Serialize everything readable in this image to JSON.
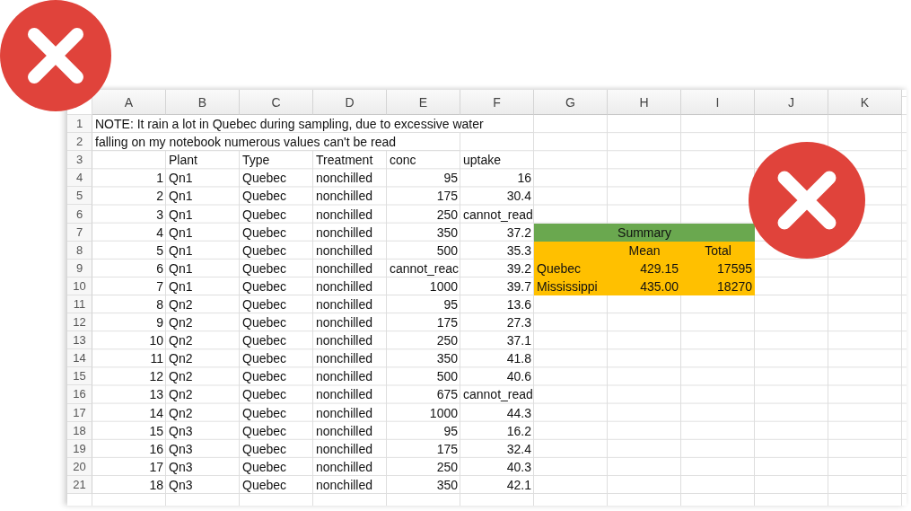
{
  "columns": [
    "A",
    "B",
    "C",
    "D",
    "E",
    "F",
    "G",
    "H",
    "I",
    "J",
    "K"
  ],
  "note_rows": [
    {
      "n": "1",
      "text": "NOTE: It rain a lot in Quebec during sampling, due to excessive water"
    },
    {
      "n": "2",
      "text": "falling on my notebook numerous values can't be read"
    }
  ],
  "header_row": {
    "n": "3",
    "plant": "Plant",
    "type": "Type",
    "treatment": "Treatment",
    "conc": "conc",
    "uptake": "uptake"
  },
  "rows": [
    {
      "n": "4",
      "id": "1",
      "plant": "Qn1",
      "type": "Quebec",
      "treatment": "nonchilled",
      "conc": "95",
      "uptake": "16"
    },
    {
      "n": "5",
      "id": "2",
      "plant": "Qn1",
      "type": "Quebec",
      "treatment": "nonchilled",
      "conc": "175",
      "uptake": "30.4"
    },
    {
      "n": "6",
      "id": "3",
      "plant": "Qn1",
      "type": "Quebec",
      "treatment": "nonchilled",
      "conc": "250",
      "uptake": "cannot_read"
    },
    {
      "n": "7",
      "id": "4",
      "plant": "Qn1",
      "type": "Quebec",
      "treatment": "nonchilled",
      "conc": "350",
      "uptake": "37.2"
    },
    {
      "n": "8",
      "id": "5",
      "plant": "Qn1",
      "type": "Quebec",
      "treatment": "nonchilled",
      "conc": "500",
      "uptake": "35.3"
    },
    {
      "n": "9",
      "id": "6",
      "plant": "Qn1",
      "type": "Quebec",
      "treatment": "nonchilled",
      "conc": "cannot_reac",
      "uptake": "39.2"
    },
    {
      "n": "10",
      "id": "7",
      "plant": "Qn1",
      "type": "Quebec",
      "treatment": "nonchilled",
      "conc": "1000",
      "uptake": "39.7"
    },
    {
      "n": "11",
      "id": "8",
      "plant": "Qn2",
      "type": "Quebec",
      "treatment": "nonchilled",
      "conc": "95",
      "uptake": "13.6"
    },
    {
      "n": "12",
      "id": "9",
      "plant": "Qn2",
      "type": "Quebec",
      "treatment": "nonchilled",
      "conc": "175",
      "uptake": "27.3"
    },
    {
      "n": "13",
      "id": "10",
      "plant": "Qn2",
      "type": "Quebec",
      "treatment": "nonchilled",
      "conc": "250",
      "uptake": "37.1"
    },
    {
      "n": "14",
      "id": "11",
      "plant": "Qn2",
      "type": "Quebec",
      "treatment": "nonchilled",
      "conc": "350",
      "uptake": "41.8"
    },
    {
      "n": "15",
      "id": "12",
      "plant": "Qn2",
      "type": "Quebec",
      "treatment": "nonchilled",
      "conc": "500",
      "uptake": "40.6"
    },
    {
      "n": "16",
      "id": "13",
      "plant": "Qn2",
      "type": "Quebec",
      "treatment": "nonchilled",
      "conc": "675",
      "uptake": "cannot_read"
    },
    {
      "n": "17",
      "id": "14",
      "plant": "Qn2",
      "type": "Quebec",
      "treatment": "nonchilled",
      "conc": "1000",
      "uptake": "44.3"
    },
    {
      "n": "18",
      "id": "15",
      "plant": "Qn3",
      "type": "Quebec",
      "treatment": "nonchilled",
      "conc": "95",
      "uptake": "16.2"
    },
    {
      "n": "19",
      "id": "16",
      "plant": "Qn3",
      "type": "Quebec",
      "treatment": "nonchilled",
      "conc": "175",
      "uptake": "32.4"
    },
    {
      "n": "20",
      "id": "17",
      "plant": "Qn3",
      "type": "Quebec",
      "treatment": "nonchilled",
      "conc": "250",
      "uptake": "40.3"
    },
    {
      "n": "21",
      "id": "18",
      "plant": "Qn3",
      "type": "Quebec",
      "treatment": "nonchilled",
      "conc": "350",
      "uptake": "42.1"
    }
  ],
  "summary": {
    "title": "Summary",
    "columns": [
      "Mean",
      "Total"
    ],
    "rows": [
      {
        "label": "Quebec",
        "mean": "429.15",
        "total": "17595"
      },
      {
        "label": "Mississippi",
        "mean": "435.00",
        "total": "18270"
      }
    ]
  }
}
